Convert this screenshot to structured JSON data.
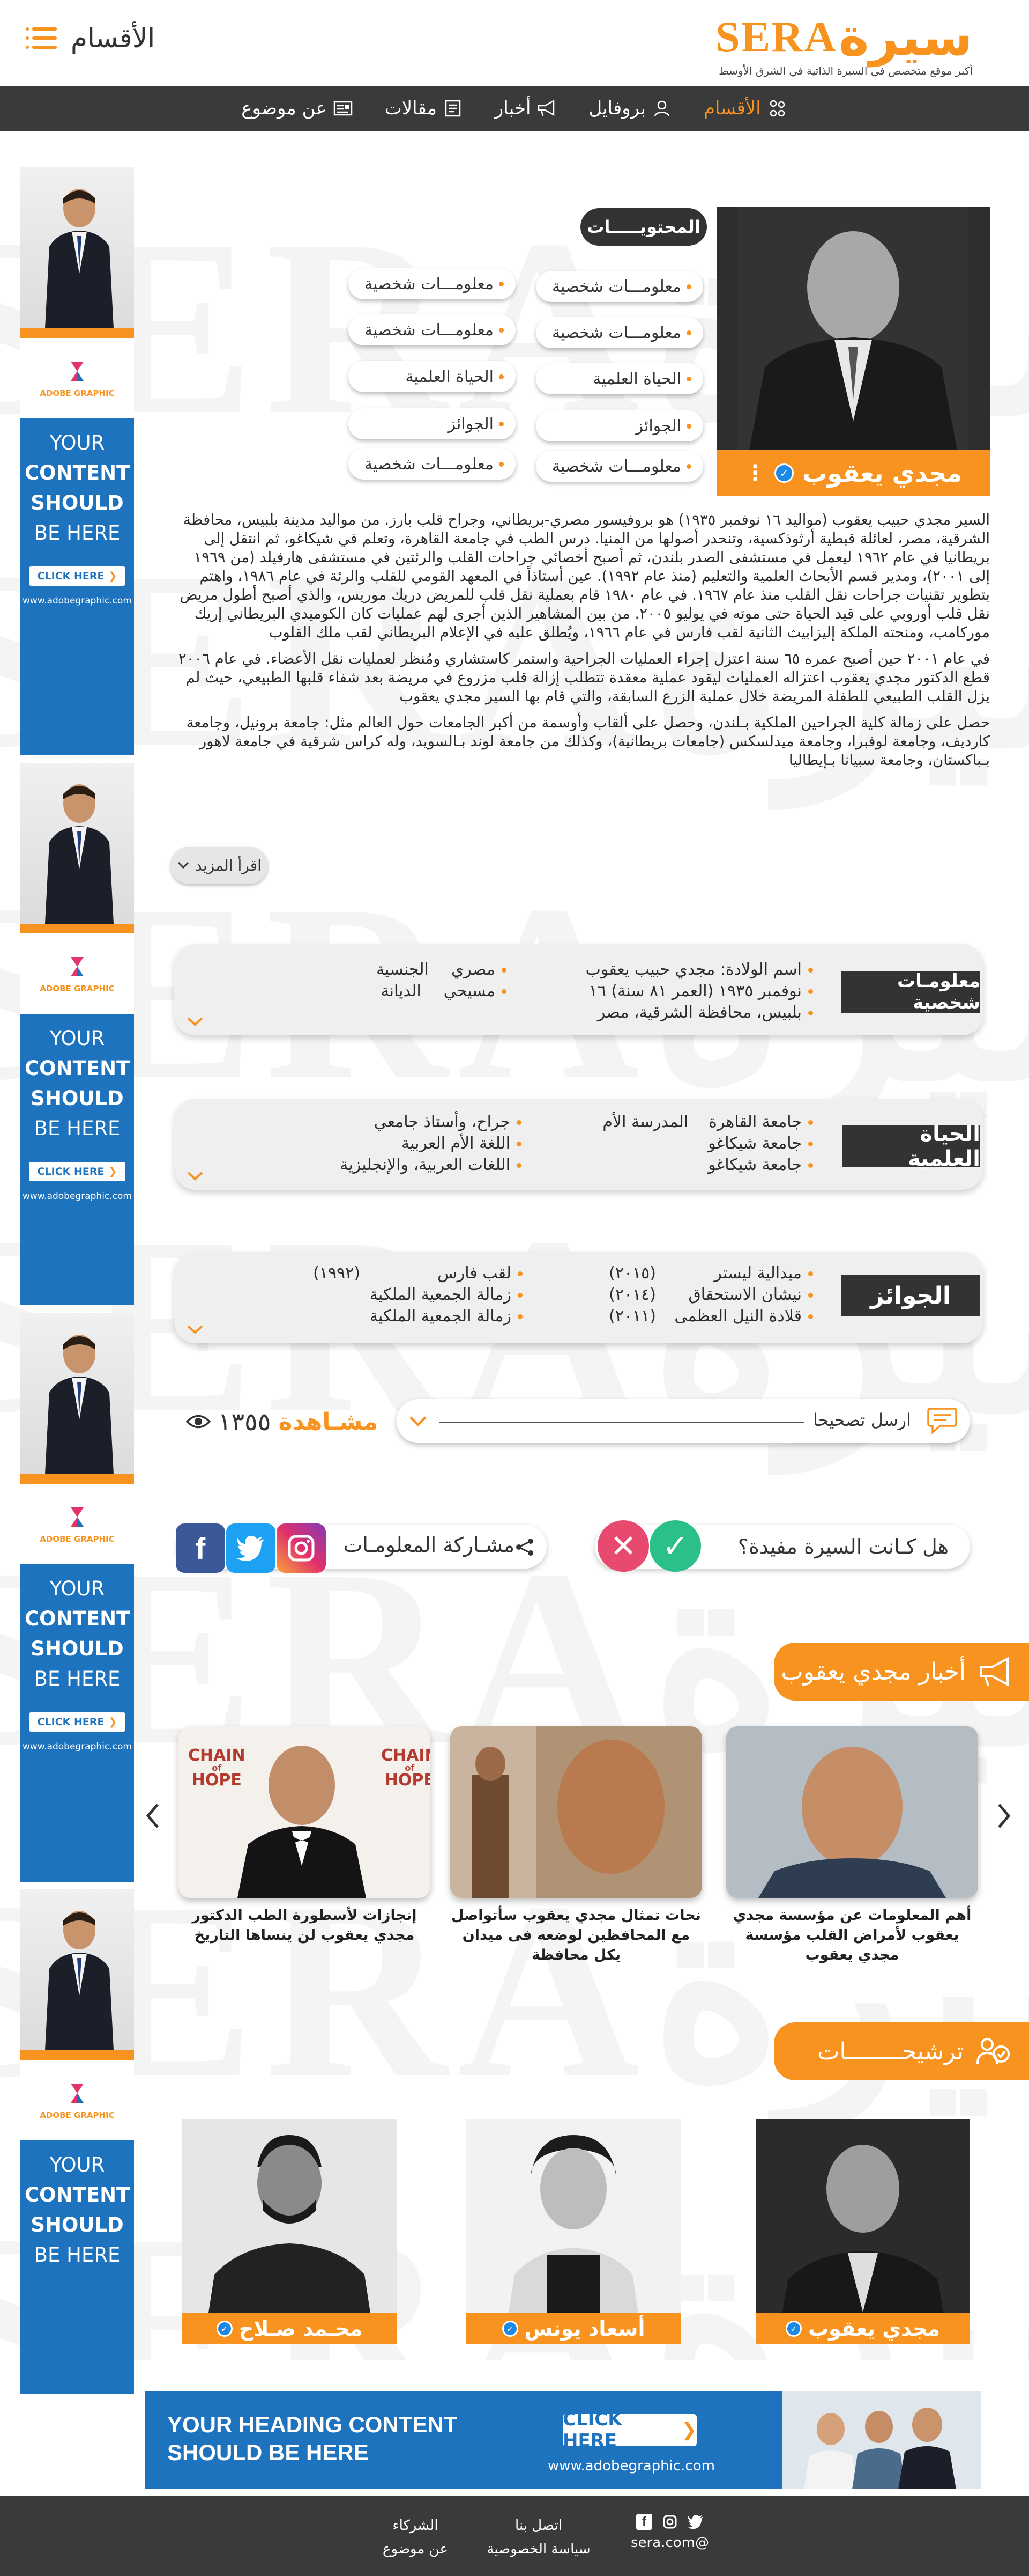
{
  "brand": {
    "logo_ar": "سيرة",
    "logo_en": "SERA",
    "tagline": "أكبر موقع متخصص في السيرة الذاتية في الشرق الأوسط",
    "sections_menu": "الأقسام"
  },
  "nav": [
    {
      "label": "الأقسام",
      "icon": "sections-icon",
      "active": true
    },
    {
      "label": "بروفايل",
      "icon": "profile-icon"
    },
    {
      "label": "أخبار",
      "icon": "megaphone-icon"
    },
    {
      "label": "مقالات",
      "icon": "article-icon"
    },
    {
      "label": "عن موضوع",
      "icon": "topic-icon"
    }
  ],
  "ad": {
    "logo_text": "ADOBE GRAPHIC",
    "line1": "YOUR",
    "line2": "CONTENT",
    "line3": "SHOULD",
    "line4": "BE HERE",
    "button": "CLICK HERE",
    "url": "www.adobegraphic.com"
  },
  "profile": {
    "name": "مجدي يعقوب",
    "toc_title": "المحتويـــــات",
    "toc_right": [
      "معلومـــات شخصية",
      "معلومـــات شخصية",
      "الحياة العلمية",
      "الجوائز",
      "معلومـــات شخصية"
    ],
    "toc_left": [
      "معلومـــات شخصية",
      "معلومـــات شخصية",
      "الحياة العلمية",
      "الجوائز",
      "معلومـــات شخصية"
    ]
  },
  "bio": {
    "p1": "السير مجدي حبيب يعقوب (مواليد ١٦ نوفمبر ١٩٣٥) هو بروفيسور مصري-بريطاني، وجراح قلب بارز. من مواليد مدينة بلبيس، محافظة الشرقية، مصر، لعائلة قبطية أرثوذكسية، وتنحدر أصولها من المنيا. درس الطب في جامعة القاهرة، وتعلم في شيكاغو، ثم انتقل إلى بريطانيا في عام ١٩٦٢ ليعمل في مستشفى الصدر بلندن، ثم أصبح أخصائي جراحات القلب والرئتين في مستشفى هارفيلد (من ١٩٦٩ إلى ٢٠٠١)، ومدير قسم الأبحاث العلمية والتعليم (منذ عام ١٩٩٢). عين أستاذاً في المعهد القومي للقلب والرئة في عام ١٩٨٦، واهتم بتطوير تقنيات جراحات نقل القلب منذ عام ١٩٦٧. في عام ١٩٨٠ قام بعملية نقل قلب للمريض دريك موريس، والذي أصبح أطول مريض نقل قلب أوروبي على قيد الحياة حتى موته في يوليو ٢٠٠٥. من بين المشاهير الذين أجرى لهم عمليات كان الكوميدي البريطاني إريك موركامب، ومنحته الملكة إليزابيث الثانية لقب فارس في عام ١٩٦٦، ويُطلق عليه في الإعلام البريطاني لقب ملك القلوب",
    "p2": "في عام ٢٠٠١ حين أصبح عمره ٦٥ سنة اعتزل إجراء العمليات الجراحية واستمر كاستشاري ومُنظر لعمليات نقل الأعضاء. في عام ٢٠٠٦ قطع الدكتور مجدي يعقوب اعتزاله العمليات ليقود عملية معقدة تتطلب إزالة قلب مزروع في مريضة بعد شفاء قلبها الطبيعي، حيث لم يزل القلب الطبيعي للطفلة المريضة خلال عملية الزرع السابقة، والتي قام بها السير مجدي يعقوب",
    "p3": "حصل على زمالة كلية الجراحين الملكية بـلندن، وحصل على ألقاب وأوسمة من أكبر الجامعات حول العالم مثل: جامعة برونيل، وجامعة كارديف، وجامعة لوفبرا، وجامعة ميدلسكس (جامعات بريطانية)، وكذلك من جامعة لوند بـالسويد، وله كراس شرقية في جامعة لاهور بـباكستان، وجامعة سبيانا بـإيطاليا",
    "read_more": "اقرأ المزيد"
  },
  "personal": {
    "label": "معلومـات شخصية",
    "right": [
      "اسم الولادة: مجدي حبيب يعقوب",
      "نوفمبر ١٩٣٥ (العمر ٨١ سنة) ١٦",
      "بلبيس، محافظة الشرقية، مصر"
    ],
    "left": [
      {
        "value": "مصري",
        "key": "الجنسية"
      },
      {
        "value": "مسيحي",
        "key": "الديانة"
      }
    ]
  },
  "science": {
    "label": "الحياة العلمية",
    "right": [
      {
        "text": "جامعة القاهرة",
        "tag": "المدرسة الأم"
      },
      {
        "text": "جامعة شيكاغو",
        "tag": ""
      },
      {
        "text": "جامعة شيكاغو",
        "tag": ""
      }
    ],
    "left": [
      "جراح، وأستاذ جامعي",
      "اللغة الأم العربية",
      "اللغات العربية، والإنجليزية"
    ]
  },
  "awards": {
    "label": "الجوائز",
    "right": [
      {
        "name": "ميدالية ليستر",
        "year": "(٢٠١٥)"
      },
      {
        "name": "نيشان الاستحقاق",
        "year": "(٢٠١٤)"
      },
      {
        "name": "قلادة النيل العظمى",
        "year": "(٢٠١١)"
      }
    ],
    "left": [
      {
        "name": "لقب فارس",
        "year": "(١٩٩٢)"
      },
      {
        "name": "زمالة الجمعية الملكية",
        "year": ""
      },
      {
        "name": "زمالة الجمعية الملكية",
        "year": ""
      }
    ]
  },
  "actions": {
    "correction": "ارسل تصحيحا",
    "views_label": "مشـاهدة",
    "views_count": "١٣٥٥",
    "useful_question": "هل كـانت السيرة مفيدة؟",
    "share_label": "مشـاركة المعلومـات"
  },
  "news": {
    "heading": "أخبار مجدي يعقوب",
    "items": [
      {
        "caption": "أهم المعلومات عن مؤسسة مجدي يعقوب لأمراض القلب مؤسسة مجدي يعقوب"
      },
      {
        "caption": "نحات تمثال مجدي يعقوب سأتواصل مع المحافظين لوضعه فى ميدان يكل محافظة"
      },
      {
        "caption": "إنجازات لأسطورة الطب الدكتور مجدي يعقوب لن ينساها التاريخ"
      }
    ],
    "photo_text_1": "CHAIN",
    "photo_text_2": "of",
    "photo_text_3": "HOPE"
  },
  "recs": {
    "heading": "ترشيحــــــــات",
    "items": [
      "مجدي يعقوب",
      "أسعاد يونس",
      "محـمد صـلاح"
    ]
  },
  "banner": {
    "line1": "YOUR HEADING CONTENT",
    "line2": "SHOULD BE HERE",
    "button": "CLICK HERE",
    "url": "www.adobegraphic.com"
  },
  "footer": {
    "email": "@sera.com",
    "links_a": [
      "اتصل بنا",
      "سياسة الخصوصية"
    ],
    "links_b": [
      "الشركاء",
      "عن موضوع"
    ]
  },
  "colors": {
    "accent": "#f7931e",
    "dark": "#3a3a3a",
    "ad_blue": "#1e73be",
    "verified": "#1e88e5"
  }
}
